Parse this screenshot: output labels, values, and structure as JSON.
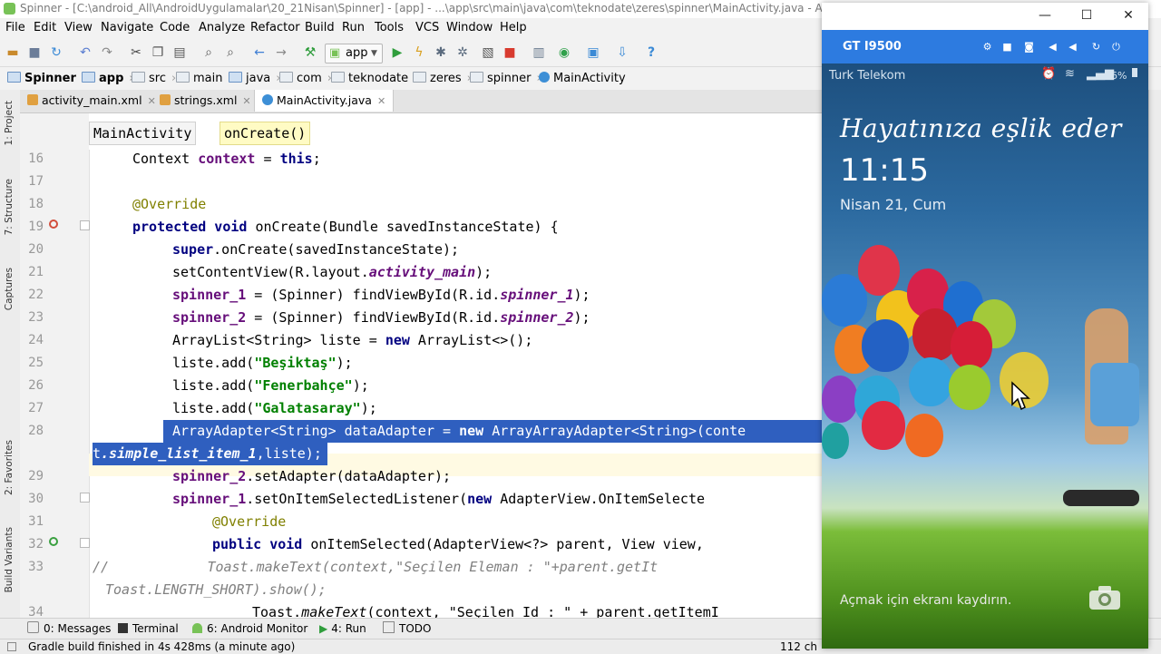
{
  "window": {
    "title": "Spinner - [C:\\android_All\\AndroidUygulamalar\\20_21Nisan\\Spinner] - [app] - ...\\app\\src\\main\\java\\com\\teknodate\\zeres\\spinner\\MainActivity.java - Android Studio 2"
  },
  "menu": [
    "File",
    "Edit",
    "View",
    "Navigate",
    "Code",
    "Analyze",
    "Refactor",
    "Build",
    "Run",
    "Tools",
    "VCS",
    "Window",
    "Help"
  ],
  "toolbar": {
    "run_config": "app",
    "help": "?"
  },
  "breadcrumb": [
    "Spinner",
    "app",
    "src",
    "main",
    "java",
    "com",
    "teknodate",
    "zeres",
    "spinner",
    "MainActivity"
  ],
  "tabs": [
    "activity_main.xml",
    "strings.xml",
    "MainActivity.java"
  ],
  "editor_breadcrumb": [
    "MainActivity",
    "onCreate()"
  ],
  "line_numbers": [
    "16",
    "17",
    "18",
    "19",
    "20",
    "21",
    "22",
    "23",
    "24",
    "25",
    "26",
    "27",
    "28",
    "29",
    "30",
    "31",
    "32",
    "33",
    "34"
  ],
  "code": {
    "l16": {
      "a": "Context ",
      "b": "context",
      "c": " = ",
      "d": "this",
      "e": ";"
    },
    "l18": "@Override",
    "l19": {
      "a": "protected void ",
      "b": "onCreate(Bundle savedInstanceState) {"
    },
    "l20": {
      "a": "super",
      "b": ".onCreate(savedInstanceState);"
    },
    "l21": {
      "a": "setContentView(R.layout.",
      "b": "activity_main",
      "c": ");"
    },
    "l22": {
      "a": "spinner_1",
      "b": " = (Spinner) findViewById(R.id.",
      "c": "spinner_1",
      "d": ");"
    },
    "l23": {
      "a": "spinner_2",
      "b": " = (Spinner) findViewById(R.id.",
      "c": "spinner_2",
      "d": ");"
    },
    "l24": {
      "a": "ArrayList<String> liste = ",
      "b": "new",
      "c": " ArrayList<>();"
    },
    "l25": {
      "a": "liste.add(",
      "b": "\"Beşiktaş\"",
      "c": ");"
    },
    "l26": {
      "a": "liste.add(",
      "b": "\"Fenerbahçe\"",
      "c": ");"
    },
    "l27": {
      "a": "liste.add(",
      "b": "\"Galatasaray\"",
      "c": ");"
    },
    "l28": {
      "a": "ArrayAdapter<String> dataAdapter = ",
      "b": "new",
      "c": " ArrayArrayAdapter<String>(conte"
    },
    "l28b": {
      "a": "t",
      "b": ".simple_list_item_1",
      "c": ",liste);"
    },
    "l29": {
      "a": "spinner_2",
      "b": ".setAdapter(dataAdapter);"
    },
    "l30": {
      "a": "spinner_1",
      "b": ".setOnItemSelectedListener(",
      "c": "new",
      "d": " AdapterView.OnItemSelecte"
    },
    "l31": "@Override",
    "l32": {
      "a": "public void ",
      "b": "onItemSelected(AdapterView<?> parent, View view,"
    },
    "l33": {
      "a": "//            ",
      "b": "Toast.makeText(context,\"Seçilen Eleman : \"+parent.getIt"
    },
    "l33b": "Toast.LENGTH_SHORT).show();",
    "l34": {
      "a": "Toast.",
      "b": "makeText",
      "c": "(context, \"Seçilen Id : \" + parent.getItemI"
    }
  },
  "bottom_tabs": [
    "0: Messages",
    "Terminal",
    "6: Android Monitor",
    "4: Run",
    "TODO"
  ],
  "status": {
    "message": "Gradle build finished in 4s 428ms (a minute ago)",
    "position": "112 ch"
  },
  "side_tools": [
    "1: Project",
    "7: Structure",
    "Captures",
    "2: Favorites",
    "Build Variants"
  ],
  "emulator": {
    "device": "GT I9500",
    "carrier": "Turk Telekom",
    "battery": "96%",
    "slogan": "Hayatınıza eşlik eder",
    "time": "11:15",
    "date": "Nisan 21, Cum",
    "unlock_hint": "Açmak için ekranı kaydırın."
  },
  "colors": {
    "accent": "#2d7be0",
    "selection": "#2f5fbf",
    "keyword": "#000080",
    "field": "#660e7a",
    "string": "#008000"
  }
}
